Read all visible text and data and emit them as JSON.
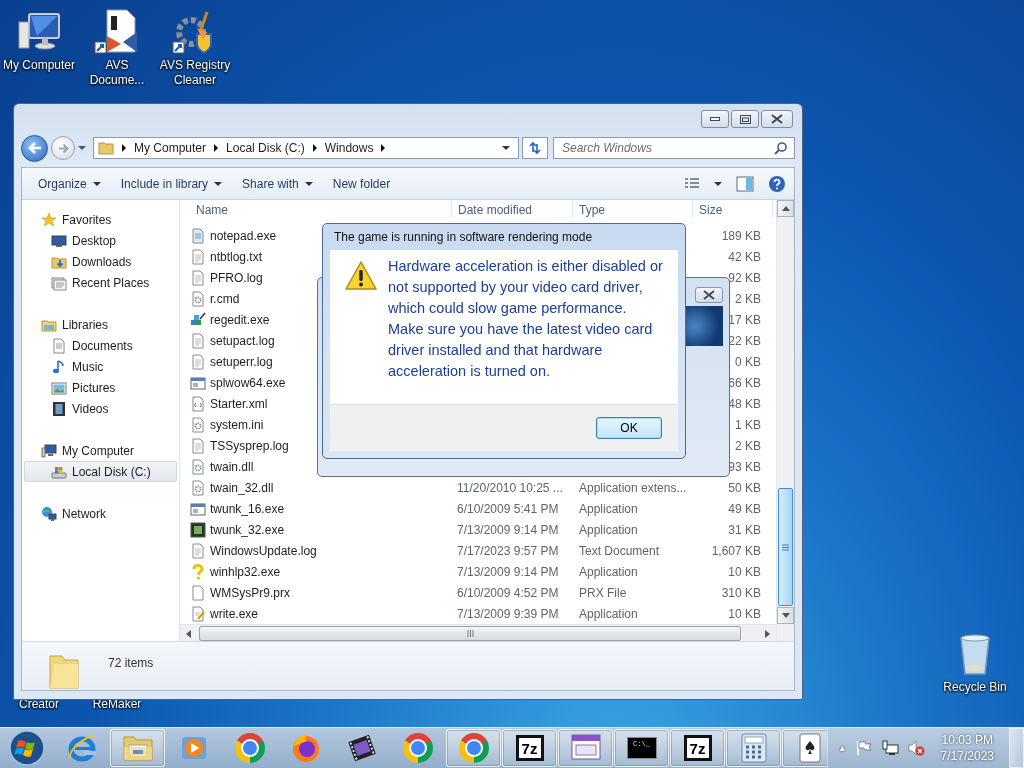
{
  "desktop_icons": [
    {
      "label": "My Computer",
      "kind": "computer"
    },
    {
      "label": "AVS Docume...",
      "kind": "avs-document"
    },
    {
      "label": "AVS Registry Cleaner",
      "kind": "avs-registry"
    },
    {
      "label": "Creator",
      "kind": "covered"
    },
    {
      "label": "ReMaker",
      "kind": "covered"
    },
    {
      "label": "Recycle Bin",
      "kind": "recycle"
    }
  ],
  "explorer": {
    "nav_buttons": [
      {
        "kind": "back",
        "disabled": false
      },
      {
        "kind": "forward",
        "disabled": true
      }
    ],
    "address": [
      "My Computer",
      "Local Disk (C:)",
      "Windows"
    ],
    "search": {
      "placeholder": "Search Windows"
    },
    "toolbar": [
      {
        "label": "Organize",
        "dropdown": true
      },
      {
        "label": "Include in library",
        "dropdown": true
      },
      {
        "label": "Share with",
        "dropdown": true
      },
      {
        "label": "New folder",
        "dropdown": false
      }
    ],
    "nav": [
      {
        "label": "Favorites",
        "kind": "star",
        "selected": false,
        "children": [
          {
            "label": "Desktop",
            "kind": "desktop",
            "selected": false
          },
          {
            "label": "Downloads",
            "kind": "downloads",
            "selected": false
          },
          {
            "label": "Recent Places",
            "kind": "recent",
            "selected": false
          }
        ]
      },
      {
        "label": "Libraries",
        "kind": "library",
        "selected": false,
        "children": [
          {
            "label": "Documents",
            "kind": "documents",
            "selected": false
          },
          {
            "label": "Music",
            "kind": "music",
            "selected": false
          },
          {
            "label": "Pictures",
            "kind": "pictures",
            "selected": false
          },
          {
            "label": "Videos",
            "kind": "videos",
            "selected": false
          }
        ]
      },
      {
        "label": "My Computer",
        "kind": "computer",
        "selected": false,
        "children": [
          {
            "label": "Local Disk (C:)",
            "kind": "disk",
            "selected": true
          }
        ]
      },
      {
        "label": "Network",
        "kind": "network",
        "selected": false
      }
    ],
    "columns": [
      "Name",
      "Date modified",
      "Type",
      "Size"
    ],
    "rows": [
      {
        "name": "notepad.exe",
        "kind": "notepad",
        "size": "189 KB"
      },
      {
        "name": "ntbtlog.txt",
        "kind": "text",
        "size": "42 KB"
      },
      {
        "name": "PFRO.log",
        "kind": "text",
        "size": "92 KB"
      },
      {
        "name": "r.cmd",
        "kind": "gear",
        "size": "2 KB"
      },
      {
        "name": "regedit.exe",
        "kind": "regedit",
        "size": "17 KB"
      },
      {
        "name": "setupact.log",
        "kind": "text",
        "size": "22 KB"
      },
      {
        "name": "setuperr.log",
        "kind": "text",
        "size": "0 KB"
      },
      {
        "name": "splwow64.exe",
        "kind": "window",
        "size": "66 KB"
      },
      {
        "name": "Starter.xml",
        "kind": "xml",
        "size": "48 KB"
      },
      {
        "name": "system.ini",
        "kind": "gear",
        "size": "1 KB"
      },
      {
        "name": "TSSysprep.log",
        "kind": "text",
        "size": "2 KB"
      },
      {
        "name": "twain.dll",
        "kind": "dll",
        "size": "93 KB"
      },
      {
        "name": "twain_32.dll",
        "kind": "dll",
        "date": "11/20/2010 10:25 ...",
        "type": "Application extens...",
        "size": "50 KB"
      },
      {
        "name": "twunk_16.exe",
        "kind": "window",
        "date": "6/10/2009 5:41 PM",
        "type": "Application",
        "size": "49 KB"
      },
      {
        "name": "twunk_32.exe",
        "kind": "app",
        "date": "7/13/2009 9:14 PM",
        "type": "Application",
        "size": "31 KB"
      },
      {
        "name": "WindowsUpdate.log",
        "kind": "text",
        "date": "7/17/2023 9:57 PM",
        "type": "Text Document",
        "size": "1,607 KB"
      },
      {
        "name": "winhlp32.exe",
        "kind": "help",
        "date": "7/13/2009 9:14 PM",
        "type": "Application",
        "size": "10 KB"
      },
      {
        "name": "WMSysPr9.prx",
        "kind": "blank",
        "date": "6/10/2009 4:52 PM",
        "type": "PRX File",
        "size": "310 KB"
      },
      {
        "name": "write.exe",
        "kind": "write",
        "date": "7/13/2009 9:39 PM",
        "type": "Application",
        "size": "10 KB"
      }
    ],
    "status": "72 items"
  },
  "dialog": {
    "title": "The game is running in software rendering mode",
    "message": "Hardware acceleration is either disabled or not supported by your video card driver, which could slow game performance. Make sure you have the latest video card driver installed and that hardware acceleration is turned on.",
    "button": "OK"
  },
  "taskbar": {
    "items": [
      {
        "kind": "ie",
        "running": false
      },
      {
        "kind": "explorer",
        "running": true
      },
      {
        "kind": "media",
        "running": false
      },
      {
        "kind": "chrome",
        "running": false
      },
      {
        "kind": "firefox",
        "running": false
      },
      {
        "kind": "video",
        "running": false
      },
      {
        "kind": "chrome",
        "running": false
      },
      {
        "kind": "chrome",
        "running": true
      },
      {
        "kind": "archive",
        "running": true,
        "text": "7z"
      },
      {
        "kind": "app",
        "running": true
      },
      {
        "kind": "cmd",
        "running": true,
        "text": "C:\\_"
      },
      {
        "kind": "archive",
        "running": true,
        "text": "7z"
      },
      {
        "kind": "calculator",
        "running": true
      },
      {
        "kind": "cards",
        "running": true
      }
    ],
    "tray": [
      {
        "kind": "show-hidden",
        "text": "▲"
      },
      {
        "kind": "flag"
      },
      {
        "kind": "network"
      },
      {
        "kind": "volume-muted"
      }
    ],
    "time": "10:03 PM",
    "date": "7/17/2023"
  }
}
